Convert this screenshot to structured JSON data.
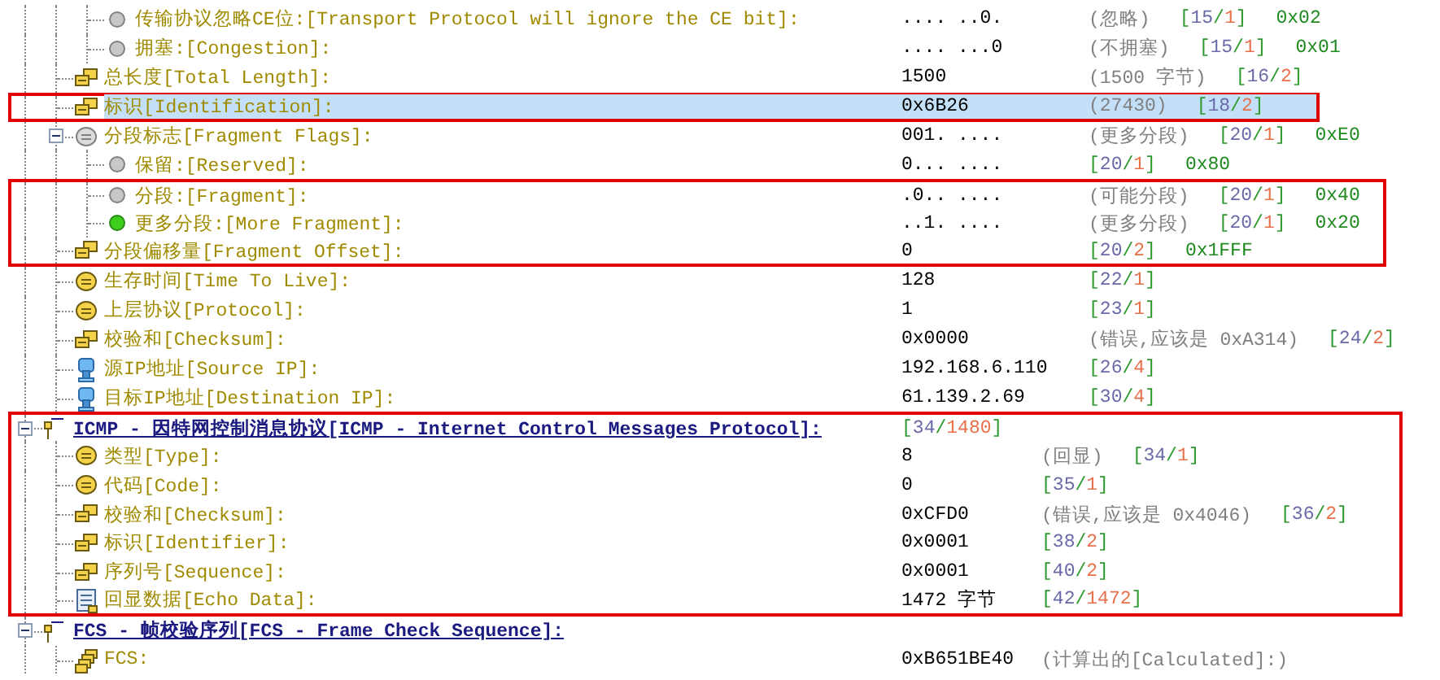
{
  "tree": [
    {
      "children": [
        {
          "children": [
            {
              "kind": "bit",
              "label": "传输协议忽略CE位:[Transport Protocol will ignore the CE bit]:",
              "set": false,
              "selected": false,
              "framed": false,
              "value": ".... ..0.",
              "note": "(忽略)",
              "ref": "[15/1]",
              "hex": "0x02"
            },
            {
              "kind": "bit",
              "label": "拥塞:[Congestion]:",
              "set": false,
              "selected": false,
              "framed": false,
              "value": ".... ...0",
              "note": "(不拥塞)",
              "ref": "[15/1]",
              "hex": "0x01"
            }
          ]
        },
        {
          "kind": "multi",
          "label": "总长度[Total Length]:",
          "selected": false,
          "framed": false,
          "value": "1500",
          "note": "(1500 字节)",
          "ref": "[16/2]"
        },
        {
          "kind": "multi",
          "label": "标识[Identification]:",
          "selected": true,
          "framed": true,
          "value": "0x6B26",
          "note": "(27430)",
          "ref": "[18/2]"
        },
        {
          "kind": "group",
          "label": "分段标志[Fragment Flags]:",
          "expanded": true,
          "selected": false,
          "framed": false,
          "value": "001. ....",
          "note": "(更多分段)",
          "ref": "[20/1]",
          "hex": "0xE0",
          "children": [
            {
              "kind": "bit",
              "label": "保留:[Reserved]:",
              "set": false,
              "selected": false,
              "framed": false,
              "value": "0... ....",
              "ref": "[20/1]",
              "hex": "0x80"
            },
            {
              "kind": "bit",
              "label": "分段:[Fragment]:",
              "set": false,
              "selected": false,
              "framed": true,
              "value": ".0.. ....",
              "note": "(可能分段)",
              "ref": "[20/1]",
              "hex": "0x40"
            },
            {
              "kind": "bit",
              "label": "更多分段:[More Fragment]:",
              "set": true,
              "selected": false,
              "framed": true,
              "value": "..1. ....",
              "note": "(更多分段)",
              "ref": "[20/1]",
              "hex": "0x20"
            }
          ]
        },
        {
          "kind": "multi",
          "label": "分段偏移量[Fragment Offset]:",
          "selected": false,
          "framed": true,
          "value": "0",
          "ref": "[20/2]",
          "hex": "0x1FFF"
        },
        {
          "kind": "byte",
          "label": "生存时间[Time To Live]:",
          "selected": false,
          "framed": false,
          "value": "128",
          "ref": "[22/1]"
        },
        {
          "kind": "byte",
          "label": "上层协议[Protocol]:",
          "selected": false,
          "framed": false,
          "value": "1",
          "ref": "[23/1]"
        },
        {
          "kind": "multi",
          "label": "校验和[Checksum]:",
          "selected": false,
          "framed": false,
          "value": "0x0000",
          "note": "(错误,应该是 0xA314)",
          "ref": "[24/2]"
        },
        {
          "kind": "host",
          "label": "源IP地址[Source IP]:",
          "selected": false,
          "framed": false,
          "value": "192.168.6.110",
          "ref": "[26/4]"
        },
        {
          "kind": "host",
          "label": "目标IP地址[Destination IP]:",
          "selected": false,
          "framed": false,
          "value": "61.139.2.69",
          "ref": "[30/4]"
        }
      ]
    },
    {
      "kind": "protocol",
      "label": "ICMP - 因特网控制消息协议[ICMP - Internet Control Messages Protocol]:",
      "expanded": true,
      "selected": false,
      "framed": true,
      "ref": "[34/1480]",
      "children": [
        {
          "kind": "byte",
          "label": "类型[Type]:",
          "selected": false,
          "framed": true,
          "value": "8",
          "note": "(回显)",
          "ref": "[34/1]"
        },
        {
          "kind": "byte",
          "label": "代码[Code]:",
          "selected": false,
          "framed": true,
          "value": "0",
          "ref": "[35/1]"
        },
        {
          "kind": "multi",
          "label": "校验和[Checksum]:",
          "selected": false,
          "framed": true,
          "value": "0xCFD0",
          "note": "(错误,应该是 0x4046)",
          "ref": "[36/2]"
        },
        {
          "kind": "multi",
          "label": "标识[Identifier]:",
          "selected": false,
          "framed": true,
          "value": "0x0001",
          "ref": "[38/2]"
        },
        {
          "kind": "multi",
          "label": "序列号[Sequence]:",
          "selected": false,
          "framed": true,
          "value": "0x0001",
          "ref": "[40/2]"
        },
        {
          "kind": "data",
          "label": "回显数据[Echo Data]:",
          "selected": false,
          "framed": true,
          "value": "1472 字节",
          "ref": "[42/1472]"
        }
      ]
    },
    {
      "kind": "protocol",
      "label": "FCS - 帧校验序列[FCS - Frame Check Sequence]:",
      "expanded": true,
      "selected": false,
      "framed": false,
      "children": [
        {
          "kind": "stack",
          "label": "FCS:",
          "selected": false,
          "framed": false,
          "value": "0xB651BE40",
          "note": "(计算出的[Calculated]:)"
        }
      ]
    }
  ]
}
